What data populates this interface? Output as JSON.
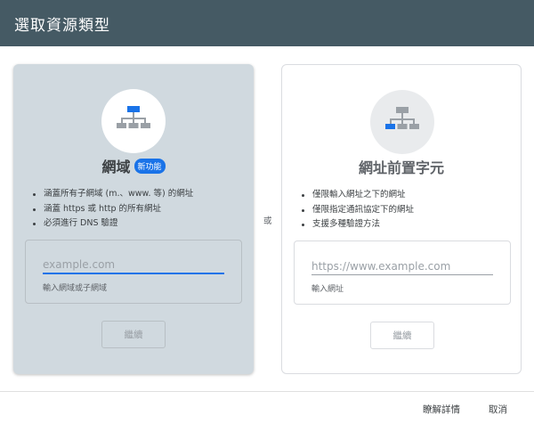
{
  "dialog": {
    "title": "選取資源類型"
  },
  "domain": {
    "title": "網域",
    "badge": "新功能",
    "bullets": [
      "涵蓋所有子網域 (m.、www. 等) 的網址",
      "涵蓋 https 或 http 的所有網址",
      "必須進行 DNS 驗證"
    ],
    "input_placeholder": "example.com",
    "input_helper": "輸入網域或子網域",
    "continue_label": "繼續",
    "icon": "sitemap-icon",
    "accent": "#1a73e8"
  },
  "or_label": "或",
  "url_prefix": {
    "title": "網址前置字元",
    "bullets": [
      "僅限輸入網址之下的網址",
      "僅限指定通訊協定下的網址",
      "支援多種驗證方法"
    ],
    "input_placeholder": "https://www.example.com",
    "input_helper": "輸入網址",
    "continue_label": "繼續",
    "icon": "sitemap-prefix-icon"
  },
  "footer": {
    "learn_more_label": "瞭解詳情",
    "cancel_label": "取消"
  },
  "colors": {
    "header_bg": "#455a64",
    "domain_card_bg": "#d0d9df",
    "accent": "#1a73e8"
  }
}
